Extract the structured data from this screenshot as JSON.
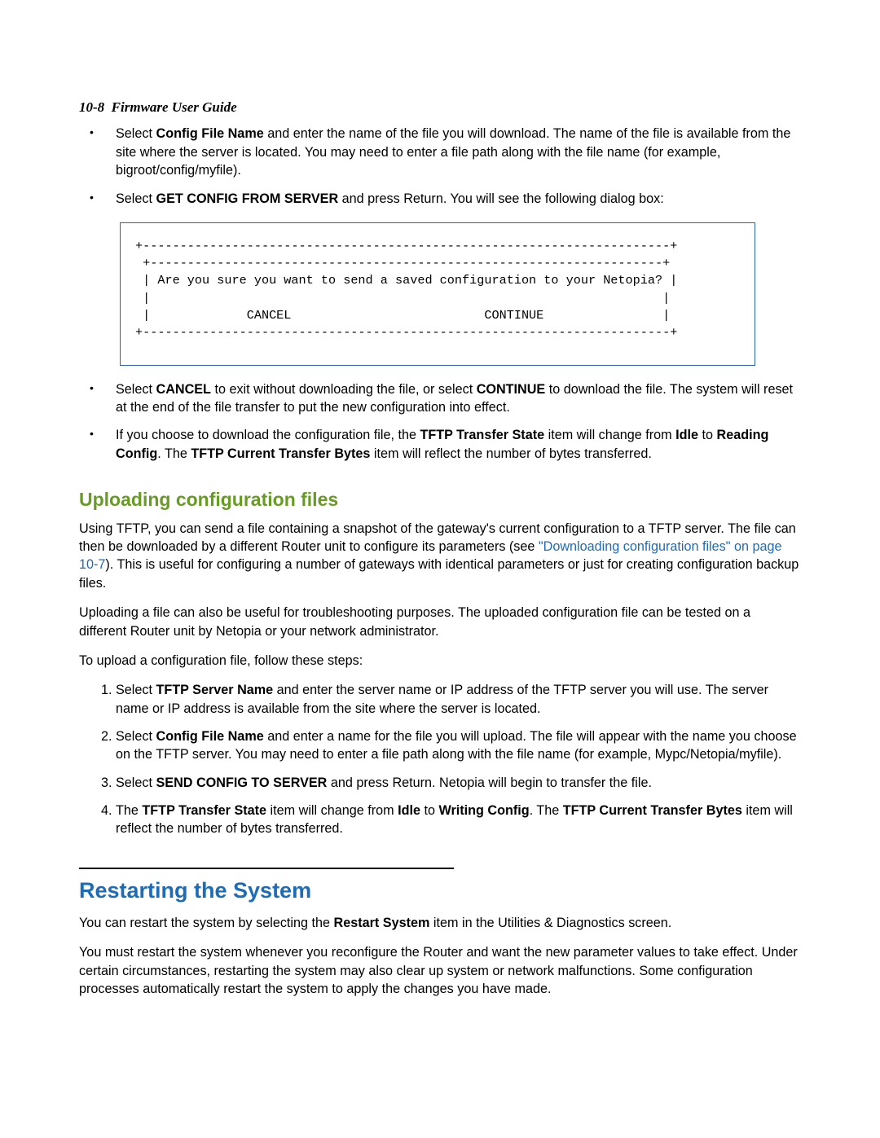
{
  "header": {
    "page_ref": "10-8",
    "doc_title": "Firmware User Guide"
  },
  "bullets_top": {
    "b1_pre": "Select ",
    "b1_strong": "Config File Name",
    "b1_post": " and enter the name of the file you will download. The name of the file is available from the site where the server is located. You may need to enter a file path along with the file name (for example, bigroot/config/myfile).",
    "b2_pre": "Select ",
    "b2_strong": "GET CONFIG FROM SERVER",
    "b2_post": " and press Return. You will see the following dialog box:"
  },
  "dialog": {
    "top_border": "+-----------------------------------------------------------------------+",
    "inner_top": "+---------------------------------------------------------------------+",
    "message_line": "| Are you sure you want to send a saved configuration to your Netopia? |",
    "blank_line": "|                                                                     |",
    "buttons_line": "|             CANCEL                          CONTINUE                |",
    "bottom_border": "+-----------------------------------------------------------------------+"
  },
  "bullets_mid": {
    "b3_pre": "Select ",
    "b3_s1": "CANCEL",
    "b3_mid1": " to exit without downloading the file, or select ",
    "b3_s2": "CONTINUE",
    "b3_post": " to download the file. The system will reset at the end of the file transfer to put the new configuration into effect.",
    "b4_pre": "If you choose to download the configuration file, the ",
    "b4_s1": "TFTP Transfer State",
    "b4_mid1": " item will change from ",
    "b4_s2": "Idle",
    "b4_mid2": " to ",
    "b4_s3": "Reading Config",
    "b4_mid3": ". The ",
    "b4_s4": "TFTP Current Transfer Bytes",
    "b4_post": " item will reflect the number of bytes transferred."
  },
  "section_upload": {
    "title": "Uploading configuration files",
    "p1_pre": "Using TFTP, you can send a file containing a snapshot of the gateway's current configuration to a TFTP server. The file can then be downloaded by a different Router unit to configure its parameters (see ",
    "p1_xref": "\"Downloading configuration files\" on page 10-7",
    "p1_post": "). This is useful for configuring a number of gateways with identical parameters or just for creating configuration backup files.",
    "p2": "Uploading a file can also be useful for troubleshooting purposes. The uploaded configuration file can be tested on a different Router unit by Netopia or your network administrator.",
    "p3": "To upload a configuration file, follow these steps:"
  },
  "steps": {
    "s1_pre": "Select ",
    "s1_s1": "TFTP Server Name",
    "s1_post": " and enter the server name or IP address of the TFTP server you will use. The server name or IP address is available from the site where the server is located.",
    "s2_pre": "Select ",
    "s2_s1": "Config File Name",
    "s2_post": " and enter a name for the file you will upload. The file will appear with the name you choose on the TFTP server. You may need to enter a file path along with the file name (for example, Mypc/Netopia/myfile).",
    "s3_pre": "Select ",
    "s3_s1": "SEND CONFIG TO SERVER",
    "s3_post": " and press Return. Netopia will begin to transfer the file.",
    "s4_pre": "The ",
    "s4_s1": "TFTP Transfer State",
    "s4_mid1": " item will change from ",
    "s4_s2": "Idle",
    "s4_mid2": " to ",
    "s4_s3": "Writing Config",
    "s4_mid3": ". The ",
    "s4_s4": "TFTP Current Transfer Bytes",
    "s4_post": " item will reflect the number of bytes transferred."
  },
  "section_restart": {
    "title": "Restarting the System",
    "p1_pre": "You can restart the system by selecting the ",
    "p1_s1": "Restart System",
    "p1_post": " item in the Utilities & Diagnostics screen.",
    "p2": "You must restart the system whenever you reconfigure the Router and want the new parameter values to take effect. Under certain circumstances, restarting the system may also clear up system or network malfunctions. Some configuration processes automatically restart the system to apply the changes you have made."
  }
}
